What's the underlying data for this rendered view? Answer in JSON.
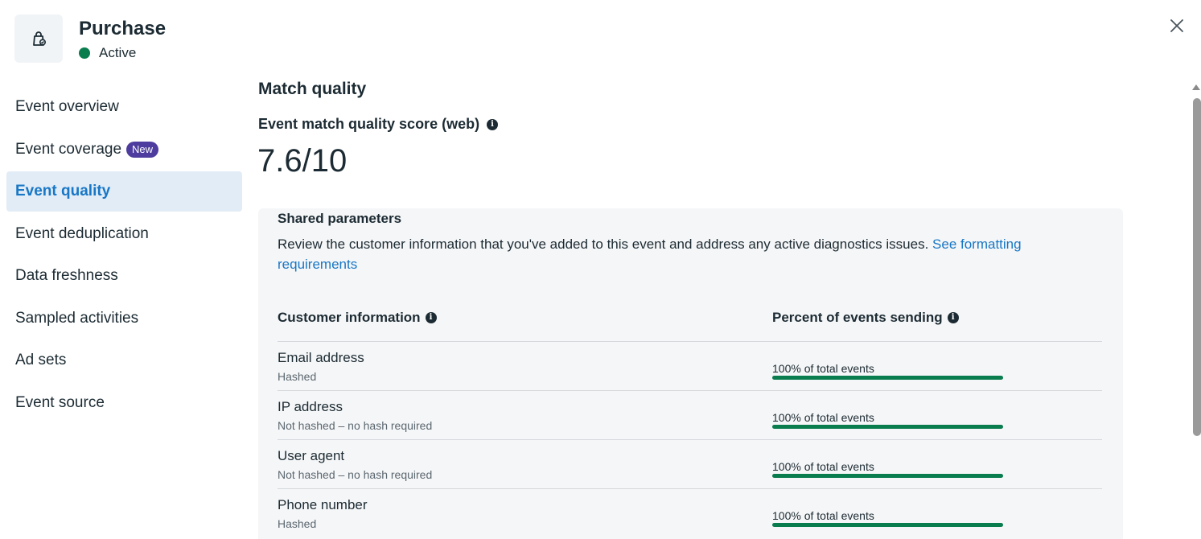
{
  "header": {
    "title": "Purchase",
    "status": "Active",
    "status_color": "#0a7d4f",
    "event_icon": "shopping-bag-icon",
    "close_icon": "close-icon"
  },
  "sidebar": {
    "items": [
      {
        "label": "Event overview",
        "active": false
      },
      {
        "label": "Event coverage",
        "active": false,
        "badge": "New"
      },
      {
        "label": "Event quality",
        "active": true
      },
      {
        "label": "Event deduplication",
        "active": false
      },
      {
        "label": "Data freshness",
        "active": false
      },
      {
        "label": "Sampled activities",
        "active": false
      },
      {
        "label": "Ad sets",
        "active": false
      },
      {
        "label": "Event source",
        "active": false
      }
    ]
  },
  "main": {
    "section_title": "Match quality",
    "score_label": "Event match quality score (web)",
    "score_value": "7.6/10",
    "info_icon": "i",
    "shared": {
      "title": "Shared parameters",
      "description": "Review the customer information that you've added to this event and address any active diagnostics issues. ",
      "link_text": "See formatting requirements",
      "col_customer": "Customer information",
      "col_percent": "Percent of events sending",
      "rows": [
        {
          "name": "Email address",
          "sub": "Hashed",
          "pct_text": "100% of total events",
          "pct": 100
        },
        {
          "name": "IP address",
          "sub": "Not hashed – no hash required",
          "pct_text": "100% of total events",
          "pct": 100
        },
        {
          "name": "User agent",
          "sub": "Not hashed – no hash required",
          "pct_text": "100% of total events",
          "pct": 100
        },
        {
          "name": "Phone number",
          "sub": "Hashed",
          "pct_text": "100% of total events",
          "pct": 100
        }
      ]
    }
  },
  "colors": {
    "accent": "#1877c6",
    "active_bg": "#e2ecf6",
    "badge_bg": "#4e3c9e",
    "bar_fill": "#0a7d4f"
  }
}
